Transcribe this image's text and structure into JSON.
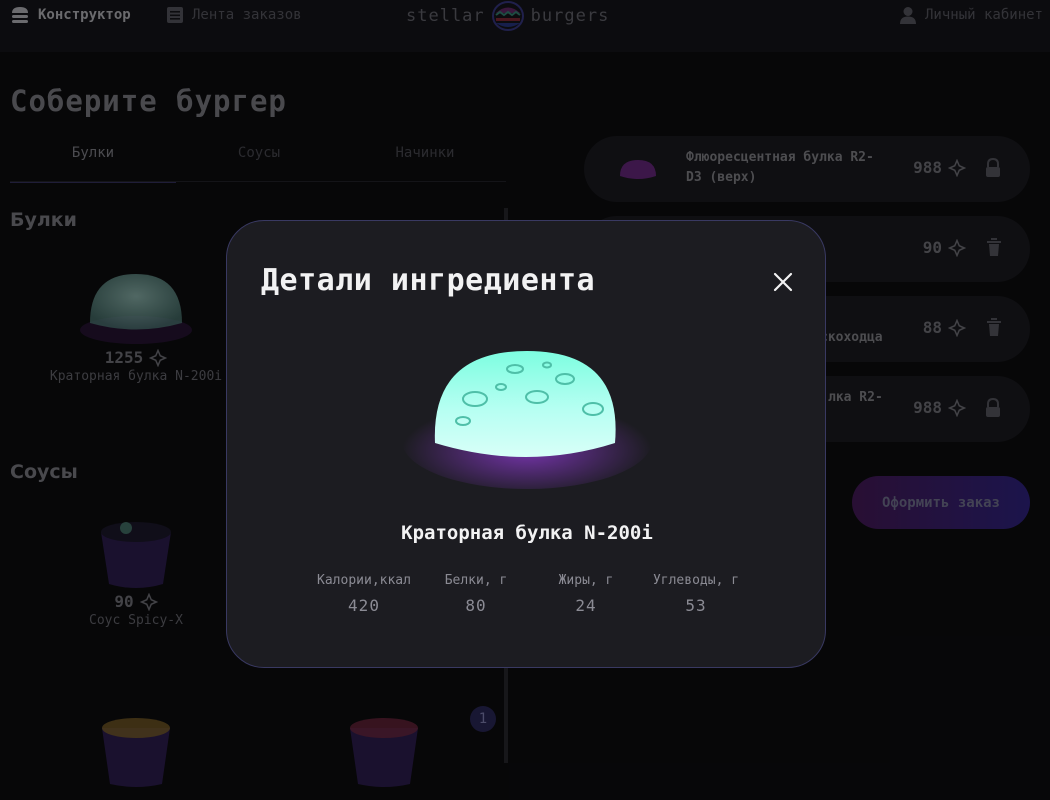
{
  "header": {
    "nav_constructor": "Конструктор",
    "nav_feed": "Лента заказов",
    "logo_left": "stellar",
    "logo_right": "burgers",
    "nav_account": "Личный кабинет"
  },
  "main": {
    "title": "Соберите бургер",
    "tabs": [
      "Булки",
      "Соусы",
      "Начинки"
    ],
    "sections": {
      "buns": "Булки",
      "sauces": "Соусы"
    },
    "items": [
      {
        "price": "1255",
        "name": "Краторная булка N-200i"
      },
      {
        "price": "90",
        "name": "Соус Spicy-X"
      }
    ],
    "counter": "1"
  },
  "constructor": {
    "rows": [
      {
        "name": "Флюоресцентная булка R2-D3 (верх)",
        "price": "988",
        "icon": "lock-icon"
      },
      {
        "name": "",
        "price": "90",
        "icon": "trash-icon"
      },
      {
        "name": "скоходца",
        "price": "88",
        "icon": "trash-icon"
      },
      {
        "name": "лка R2-",
        "price": "988",
        "icon": "lock-icon"
      }
    ],
    "order_button": "Оформить заказ"
  },
  "modal": {
    "title": "Детали ингредиента",
    "ingredient_name": "Краторная булка N-200i",
    "nutrition": [
      {
        "label": "Калории,ккал",
        "value": "420"
      },
      {
        "label": "Белки, г",
        "value": "80"
      },
      {
        "label": "Жиры, г",
        "value": "24"
      },
      {
        "label": "Углеводы, г",
        "value": "53"
      }
    ]
  },
  "colors": {
    "accent": "#4c4cff",
    "background": "#131316",
    "modal_bg": "#1c1c21",
    "bun_glow": "#7dfde0"
  }
}
